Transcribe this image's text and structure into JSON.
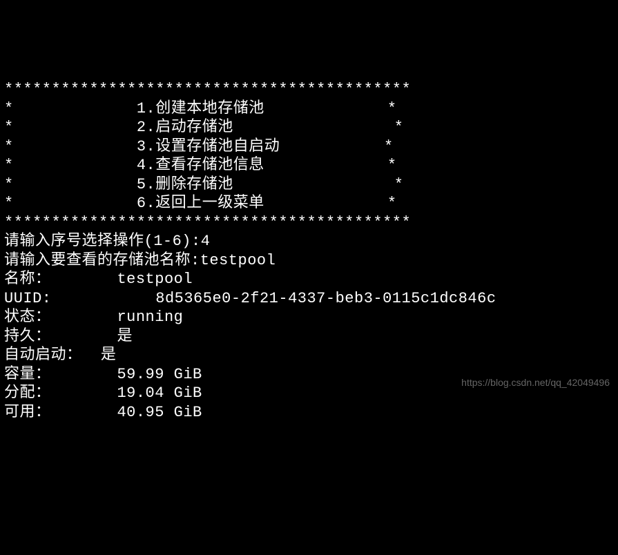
{
  "menu": {
    "border_top": "*******************************************",
    "items": [
      {
        "left": "*",
        "num": "1",
        "label": "创建本地存储池",
        "right": "*"
      },
      {
        "left": "*",
        "num": "2",
        "label": "启动存储池",
        "right": "*"
      },
      {
        "left": "*",
        "num": "3",
        "label": "设置存储池自启动",
        "right": "*"
      },
      {
        "left": "*",
        "num": "4",
        "label": "查看存储池信息",
        "right": "*"
      },
      {
        "left": "*",
        "num": "5",
        "label": "删除存储池",
        "right": "*"
      },
      {
        "left": "*",
        "num": "6",
        "label": "返回上一级菜单",
        "right": "*"
      }
    ],
    "border_bottom": "*******************************************"
  },
  "prompts": {
    "select_prompt": "请输入序号选择操作(1-6):",
    "select_input": "4",
    "pool_prompt": "请输入要查看的存储池名称:",
    "pool_input": "testpool"
  },
  "pool_info": {
    "name_label": "名称：",
    "name_value": "testpool",
    "uuid_label": "UUID:",
    "uuid_value": "8d5365e0-2f21-4337-beb3-0115c1dc846c",
    "state_label": "状态：",
    "state_value": "running",
    "persistent_label": "持久：",
    "persistent_value": "是",
    "autostart_label": "自动启动：",
    "autostart_value": "是",
    "capacity_label": "容量：",
    "capacity_value": "59.99 GiB",
    "allocation_label": "分配：",
    "allocation_value": "19.04 GiB",
    "available_label": "可用：",
    "available_value": "40.95 GiB"
  },
  "watermark": "https://blog.csdn.net/qq_42049496"
}
